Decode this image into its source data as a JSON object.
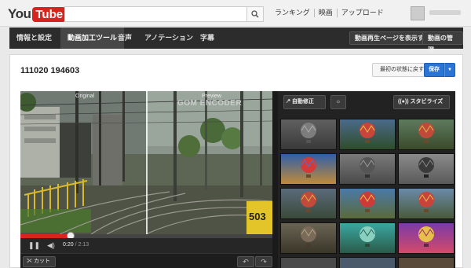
{
  "logo": {
    "you": "You",
    "tube": "Tube"
  },
  "search": {
    "placeholder": "",
    "icon": "search-icon"
  },
  "topnav": [
    "ランキング",
    "映画",
    "アップロード"
  ],
  "subnav": {
    "tabs": [
      "情報と設定",
      "動画加工ツール",
      "音声",
      "アノテーション",
      "字幕"
    ],
    "active_tab": "動画加工ツール",
    "view_page_label": "動画再生ページを表示する",
    "manage_label": "動画の管理"
  },
  "editor": {
    "video_title": "111020 194603",
    "revert_label": "最初の状態に戻す",
    "save_label": "保存",
    "original_label": "Original",
    "preview_label": "Preview",
    "watermark": "GOM ENCODER",
    "time_current": "0:20",
    "time_total": "2:13",
    "progress": 0.2,
    "cut_label": "カット",
    "sign_text": "503"
  },
  "tools": {
    "auto_fix_label": "自動修正",
    "stabilize_label": "スタビライズ"
  },
  "colors": {
    "accent_red": "#d8241e",
    "save_blue": "#2a74d6"
  }
}
